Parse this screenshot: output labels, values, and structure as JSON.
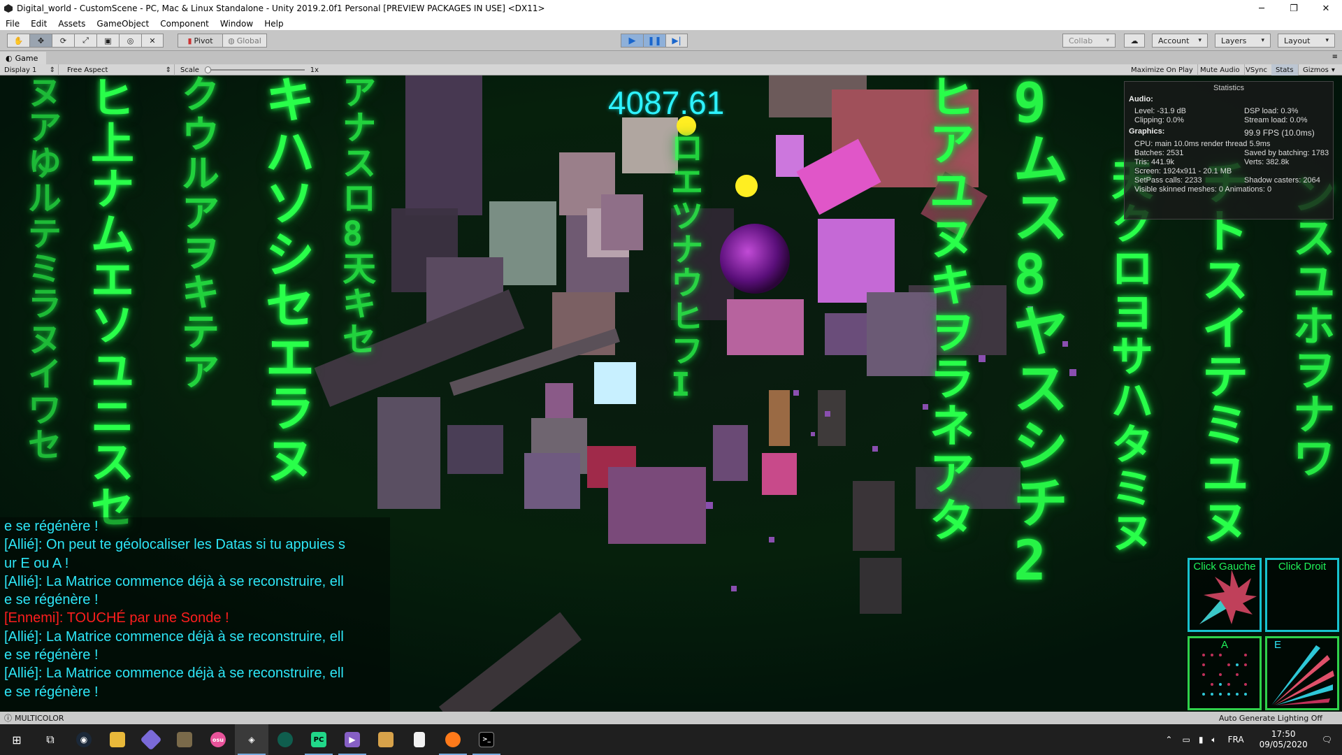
{
  "window": {
    "title": "Digital_world - CustomScene - PC, Mac & Linux Standalone - Unity 2019.2.0f1 Personal [PREVIEW PACKAGES IN USE] <DX11>",
    "minimize": "─",
    "maximize": "❐",
    "close": "✕"
  },
  "menu": [
    "File",
    "Edit",
    "Assets",
    "GameObject",
    "Component",
    "Window",
    "Help"
  ],
  "toolbar": {
    "pivot": "Pivot",
    "global": "Global",
    "collab": "Collab",
    "account": "Account",
    "layers": "Layers",
    "layout": "Layout"
  },
  "game_tab": {
    "label": "Game"
  },
  "game_bar": {
    "display": "Display 1",
    "aspect": "Free Aspect",
    "scale_label": "Scale",
    "scale_value": "1x",
    "maximize_on_play": "Maximize On Play",
    "mute_audio": "Mute Audio",
    "vsync": "VSync",
    "stats": "Stats",
    "gizmos": "Gizmos"
  },
  "score": "4087.61",
  "stats": {
    "title": "Statistics",
    "audio_header": "Audio:",
    "level": "Level: -31.9 dB",
    "clipping": "Clipping: 0.0%",
    "dsp_load": "DSP load: 0.3%",
    "stream_load": "Stream load: 0.0%",
    "graphics_header": "Graphics:",
    "fps": "99.9 FPS (10.0ms)",
    "cpu": "CPU: main 10.0ms   render thread 5.9ms",
    "batches": "Batches: 2531",
    "saved_batching": "Saved by batching: 1783",
    "tris": "Tris: 441.9k",
    "verts": "Verts: 382.8k",
    "screen": "Screen: 1924x911 - 20.1 MB",
    "setpass": "SetPass calls: 2233",
    "shadow_casters": "Shadow casters: 2064",
    "skinned": "Visible skinned meshes: 0  Animations: 0"
  },
  "chat": [
    {
      "text": "e se régénère !",
      "type": "ally"
    },
    {
      "text": "[Allié]: On peut te géolocaliser les Datas si tu appuies s",
      "type": "ally"
    },
    {
      "text": "ur E ou A !",
      "type": "ally"
    },
    {
      "text": "[Allié]: La Matrice commence déjà à se reconstruire, ell",
      "type": "ally"
    },
    {
      "text": "e se régénère !",
      "type": "ally"
    },
    {
      "text": "[Ennemi]: TOUCHÉ par une Sonde !",
      "type": "enemy"
    },
    {
      "text": "[Allié]: La Matrice commence déjà à se reconstruire, ell",
      "type": "ally"
    },
    {
      "text": "e se régénère !",
      "type": "ally"
    },
    {
      "text": "[Allié]: La Matrice commence déjà à se reconstruire, ell",
      "type": "ally"
    },
    {
      "text": "e se régénère !",
      "type": "ally"
    }
  ],
  "hud": {
    "left_click": "Click Gauche",
    "right_click": "Click Droit",
    "key_a": "A",
    "key_e": "E"
  },
  "status": {
    "left": "MULTICOLOR",
    "right": "Auto Generate Lighting Off"
  },
  "taskbar": {
    "time": "17:50",
    "date": "09/05/2020",
    "lang": "FRA"
  },
  "colors": {
    "matrix_green": "#29ff4a",
    "score_cyan": "#2ef2ff",
    "ally": "#2ee6f7",
    "enemy": "#ff1e1e"
  }
}
